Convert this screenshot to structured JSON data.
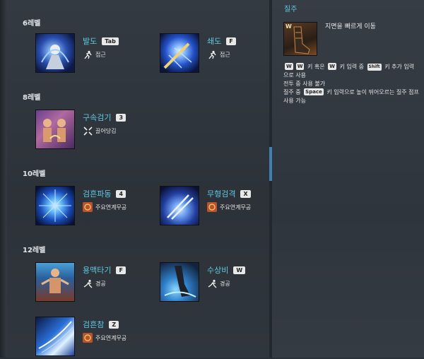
{
  "levels": [
    {
      "label": "6레벨"
    },
    {
      "label": "8레벨"
    },
    {
      "label": "10레벨"
    },
    {
      "label": "12레벨"
    }
  ],
  "skills": [
    {
      "name": "발도",
      "key": "Tab",
      "tag": "접근",
      "tag_icon": "approach-icon"
    },
    {
      "name": "쇄도",
      "key": "F",
      "tag": "접근",
      "tag_icon": "approach-icon"
    },
    {
      "name": "구속검기",
      "key": "3",
      "tag": "끌어당김",
      "tag_icon": "pull-icon"
    },
    {
      "name": "검흔파동",
      "key": "4",
      "tag": "주요연계무공",
      "tag_icon": "combo-skill-icon"
    },
    {
      "name": "무형검격",
      "key": "X",
      "tag": "주요연계무공",
      "tag_icon": "combo-skill-icon"
    },
    {
      "name": "용맥타기",
      "key": "F",
      "tag": "경공",
      "tag_icon": "lightfoot-icon"
    },
    {
      "name": "수상비",
      "key": "W",
      "tag": "경공",
      "tag_icon": "lightfoot-icon"
    },
    {
      "name": "검흔참",
      "key": "Z",
      "tag": "주요연계무공",
      "tag_icon": "combo-skill-icon"
    }
  ],
  "detail": {
    "title": "질주",
    "subtitle": "지면을 빠르게 이동",
    "icon_badge": "W",
    "line1": {
      "k1": "W",
      "k2": "W",
      "t1": "키 혹은",
      "k3": "W",
      "t2": "키 입력 중",
      "k4": "Shift",
      "t3": "키 추가 입력으로 사용"
    },
    "line2": "전투 중 사용 불가",
    "line3": {
      "t1": "질주 중",
      "k1": "Space",
      "t2": "키 입력으로 높이 뛰어오르는 질주 점프 사용 가능"
    }
  },
  "colors": {
    "accent": "#5fc9e3",
    "panel": "#2f353c",
    "scrollbar": "#3f7fb3"
  }
}
